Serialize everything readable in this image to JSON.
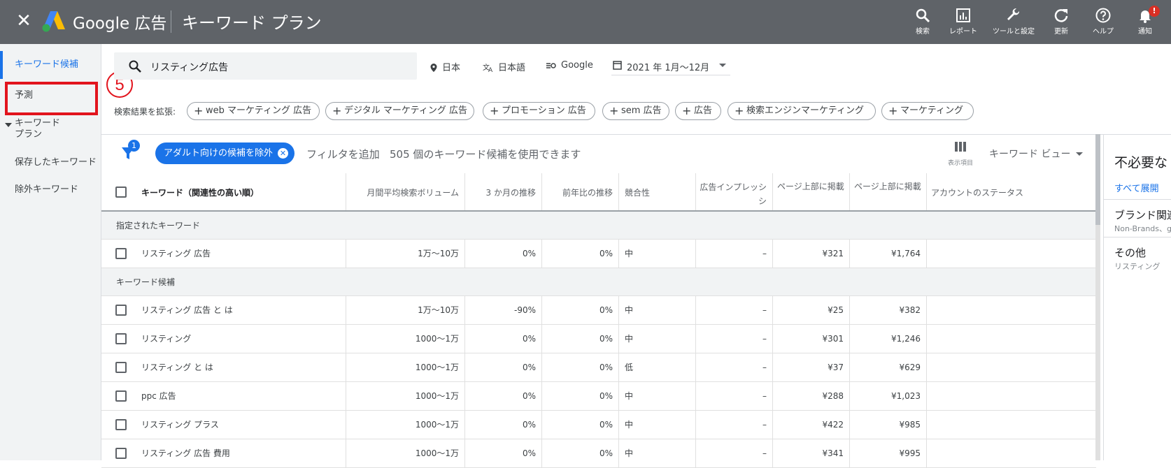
{
  "header": {
    "brand": "Google 広告",
    "title": "キーワード プラン",
    "tools": [
      {
        "label": "検索",
        "icon": "search-icon"
      },
      {
        "label": "レポート",
        "icon": "report-icon"
      },
      {
        "label": "ツールと設定",
        "icon": "wrench-icon"
      },
      {
        "label": "更新",
        "icon": "refresh-icon"
      },
      {
        "label": "ヘルプ",
        "icon": "help-icon"
      },
      {
        "label": "通知",
        "icon": "bell-icon"
      }
    ],
    "notification_badge": "!"
  },
  "sidebar": {
    "items": [
      {
        "label": "キーワード候補"
      },
      {
        "label": "予測"
      },
      {
        "label": "キーワード\nプラン"
      },
      {
        "label": "保存したキーワード"
      },
      {
        "label": "除外キーワード"
      }
    ]
  },
  "annotation": {
    "number": "⑤",
    "color": "#e2141d"
  },
  "search": {
    "query": "リスティング広告",
    "location": "日本",
    "language": "日本語",
    "network": "Google",
    "date_range": "2021 年 1月～12月"
  },
  "expand": {
    "label": "検索結果を拡張:",
    "chips": [
      "web マーケティング 広告",
      "デジタル マーケティング 広告",
      "プロモーション 広告",
      "sem 広告",
      "広告",
      "検索エンジンマーケティング",
      "マーケティング"
    ]
  },
  "filterbar": {
    "filter_count": "1",
    "adult_chip": "アダルト向けの候補を除外",
    "add_filter": "フィルタを追加",
    "available": "505 個のキーワード候補を使用できます",
    "columns_label": "表示項目",
    "view_label": "キーワード ビュー"
  },
  "table": {
    "columns": [
      "キーワード（関連性の高い順）",
      "月間平均検索ボリューム",
      "3 か月の推移",
      "前年比の推移",
      "競合性",
      "広告インプレッシ\nシ",
      "ページ上部に掲載",
      "ページ上部に掲載",
      "アカウントのステータス"
    ],
    "group_specified": "指定されたキーワード",
    "specified_rows": [
      {
        "keyword": "リスティング 広告",
        "volume": "1万～10万",
        "three_month": "0%",
        "yoy": "0%",
        "competition": "中",
        "impression": "–",
        "low_bid": "¥321",
        "high_bid": "¥1,764"
      }
    ],
    "group_ideas": "キーワード候補",
    "idea_rows": [
      {
        "keyword": "リスティング 広告 と は",
        "volume": "1万～10万",
        "three_month": "-90%",
        "yoy": "0%",
        "competition": "中",
        "impression": "–",
        "low_bid": "¥25",
        "high_bid": "¥382"
      },
      {
        "keyword": "リスティング",
        "volume": "1000～1万",
        "three_month": "0%",
        "yoy": "0%",
        "competition": "中",
        "impression": "–",
        "low_bid": "¥301",
        "high_bid": "¥1,246"
      },
      {
        "keyword": "リスティング と は",
        "volume": "1000～1万",
        "three_month": "0%",
        "yoy": "0%",
        "competition": "低",
        "impression": "–",
        "low_bid": "¥37",
        "high_bid": "¥629"
      },
      {
        "keyword": "ppc 広告",
        "volume": "1000～1万",
        "three_month": "0%",
        "yoy": "0%",
        "competition": "中",
        "impression": "–",
        "low_bid": "¥288",
        "high_bid": "¥1,023"
      },
      {
        "keyword": "リスティング プラス",
        "volume": "1000～1万",
        "three_month": "0%",
        "yoy": "0%",
        "competition": "中",
        "impression": "–",
        "low_bid": "¥422",
        "high_bid": "¥985"
      },
      {
        "keyword": "リスティング 広告 費用",
        "volume": "1000～1万",
        "three_month": "0%",
        "yoy": "0%",
        "competition": "中",
        "impression": "–",
        "low_bid": "¥341",
        "high_bid": "¥995"
      }
    ]
  },
  "right_panel": {
    "title": "不必要な",
    "expand_all": "すべて展開",
    "groups": [
      {
        "name": "ブランド関連",
        "sub": "Non-Brands、g"
      },
      {
        "name": "その他",
        "sub": "リスティング"
      }
    ]
  }
}
